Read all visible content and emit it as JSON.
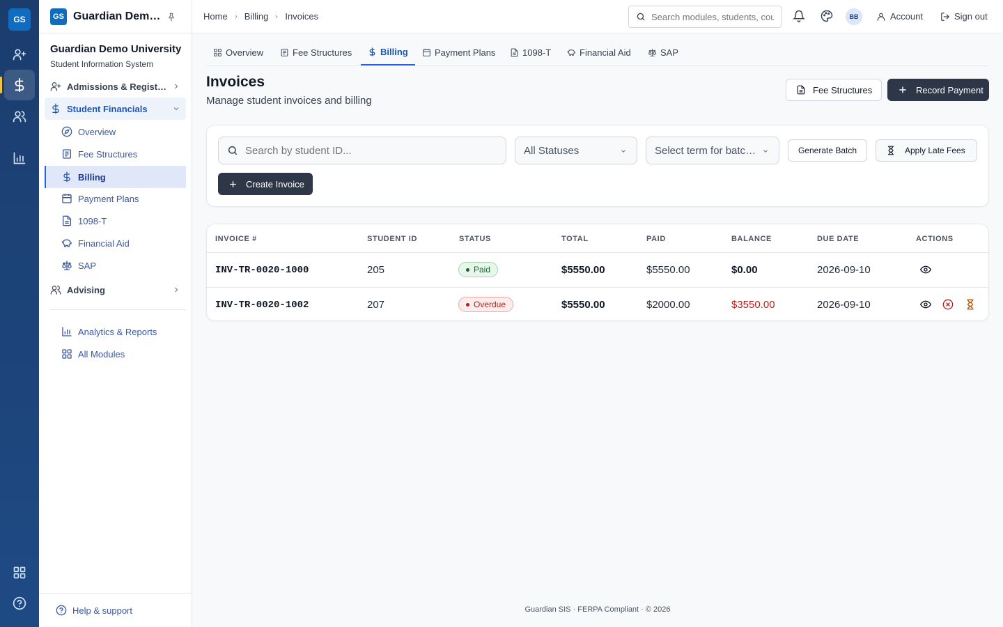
{
  "rail": {
    "logo": "GS",
    "icons": [
      "user-plus-icon",
      "dollar-icon",
      "users-icon",
      "bar-chart-icon",
      "grid-icon",
      "help-circle-icon"
    ]
  },
  "sidebar": {
    "logo": "GS",
    "app_name": "Guardian Demo University",
    "university": "Guardian Demo University",
    "system": "Student Information System",
    "sections": [
      {
        "label": "Admissions & Registration"
      },
      {
        "label": "Student Financials"
      },
      {
        "label": "Advising"
      }
    ],
    "sub_items": [
      {
        "label": "Overview"
      },
      {
        "label": "Fee Structures"
      },
      {
        "label": "Billing"
      },
      {
        "label": "Payment Plans"
      },
      {
        "label": "1098-T"
      },
      {
        "label": "Financial Aid"
      },
      {
        "label": "SAP"
      }
    ],
    "extras": [
      {
        "label": "Analytics & Reports"
      },
      {
        "label": "All Modules"
      }
    ],
    "help": "Help & support"
  },
  "topbar": {
    "breadcrumbs": [
      "Home",
      "Billing",
      "Invoices"
    ],
    "search_placeholder": "Search modules, students, courses",
    "avatar": "BB",
    "account": "Account",
    "signout": "Sign out"
  },
  "tabs": [
    {
      "label": "Overview"
    },
    {
      "label": "Fee Structures"
    },
    {
      "label": "Billing"
    },
    {
      "label": "Payment Plans"
    },
    {
      "label": "1098-T"
    },
    {
      "label": "Financial Aid"
    },
    {
      "label": "SAP"
    }
  ],
  "page": {
    "title": "Invoices",
    "subtitle": "Manage student invoices and billing",
    "fee_structures_btn": "Fee Structures",
    "record_payment_btn": "Record Payment"
  },
  "filters": {
    "search_placeholder": "Search by student ID...",
    "status_value": "All Statuses",
    "term_value": "Select term for batch...",
    "generate_batch": "Generate Batch",
    "apply_late_fees": "Apply Late Fees",
    "create_invoice": "Create Invoice"
  },
  "table": {
    "headers": [
      "INVOICE #",
      "STUDENT ID",
      "STATUS",
      "TOTAL",
      "PAID",
      "BALANCE",
      "DUE DATE",
      "ACTIONS"
    ],
    "rows": [
      {
        "invoice": "INV-TR-0020-1000",
        "student_id": "205",
        "status": "Paid",
        "total": "$5550.00",
        "paid": "$5550.00",
        "balance": "$0.00",
        "due": "2026-09-10"
      },
      {
        "invoice": "INV-TR-0020-1002",
        "student_id": "207",
        "status": "Overdue",
        "total": "$5550.00",
        "paid": "$2000.00",
        "balance": "$3550.00",
        "due": "2026-09-10"
      }
    ]
  },
  "footer": "Guardian SIS · FERPA Compliant · © 2026",
  "colors": {
    "rail": "#1b3d6e",
    "accent": "#2563eb",
    "dark_button": "#2d3748",
    "overdue": "#b91c1c",
    "paid": "#166534"
  }
}
